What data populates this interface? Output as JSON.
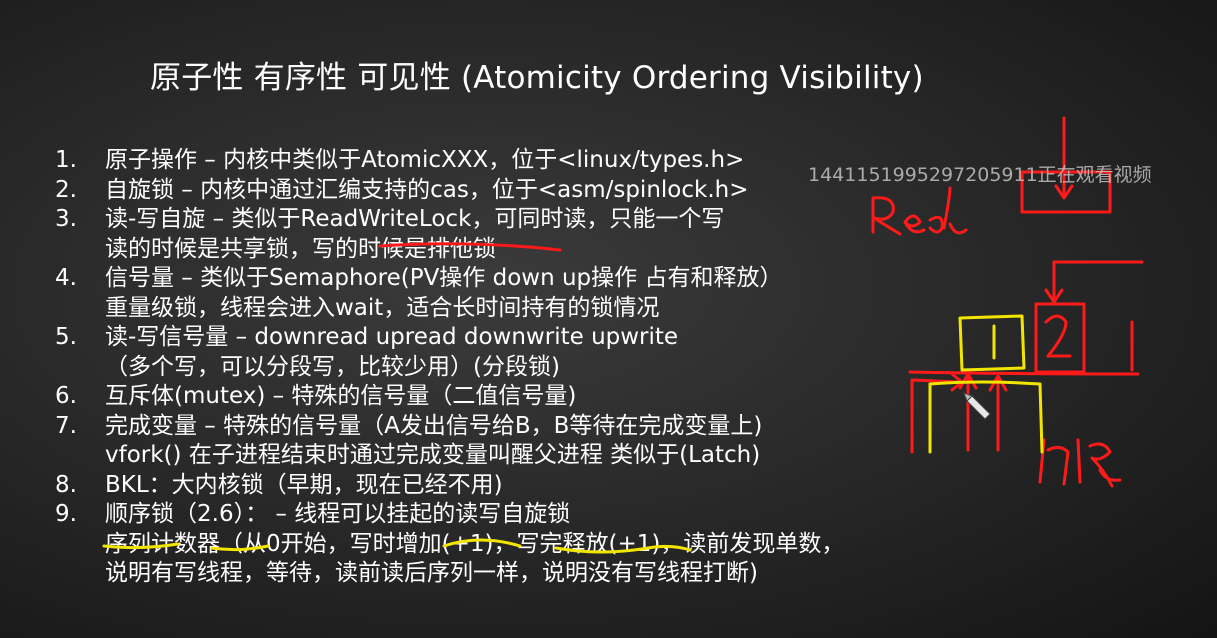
{
  "slide": {
    "title": "原子性 有序性 可见性 (Atomicity Ordering Visibility)",
    "items": [
      {
        "num": "1.",
        "lines": [
          "原子操作 – 内核中类似于AtomicXXX，位于<linux/types.h>"
        ]
      },
      {
        "num": "2.",
        "lines": [
          "自旋锁 – 内核中通过汇编支持的cas，位于<asm/spinlock.h>"
        ]
      },
      {
        "num": "3.",
        "lines": [
          "读-写自旋 – 类似于ReadWriteLock，可同时读，只能一个写",
          "读的时候是共享锁，写的时候是排他锁"
        ]
      },
      {
        "num": "4.",
        "lines": [
          "信号量 – 类似于Semaphore(PV操作 down up操作 占有和释放）",
          "重量级锁，线程会进入wait，适合长时间持有的锁情况"
        ]
      },
      {
        "num": "5.",
        "lines": [
          "读-写信号量 – downread upread downwrite upwrite",
          "（多个写，可以分段写，比较少用）(分段锁)"
        ]
      },
      {
        "num": "6.",
        "lines": [
          "互斥体(mutex) – 特殊的信号量（二值信号量)"
        ]
      },
      {
        "num": "7.",
        "lines": [
          "完成变量 – 特殊的信号量（A发出信号给B，B等待在完成变量上)",
          "vfork() 在子进程结束时通过完成变量叫醒父进程 类似于(Latch)"
        ]
      },
      {
        "num": "8.",
        "lines": [
          "BKL：大内核锁（早期，现在已经不用)"
        ]
      },
      {
        "num": "9.",
        "lines": [
          "顺序锁（2.6）： – 线程可以挂起的读写自旋锁",
          "序列计数器（从0开始，写时增加(+1)，写完释放(+1)，读前发现单数，",
          "说明有写线程，等待，读前读后序列一样，说明没有写线程打断)"
        ]
      }
    ]
  },
  "watermark": "1441151995297205911正在观看视频",
  "colors": {
    "annotation_red": "#ff1a1a",
    "annotation_yellow": "#f2e600",
    "background": "#2b2b2b"
  },
  "icons": {
    "cursor": "pencil-cursor-icon"
  }
}
